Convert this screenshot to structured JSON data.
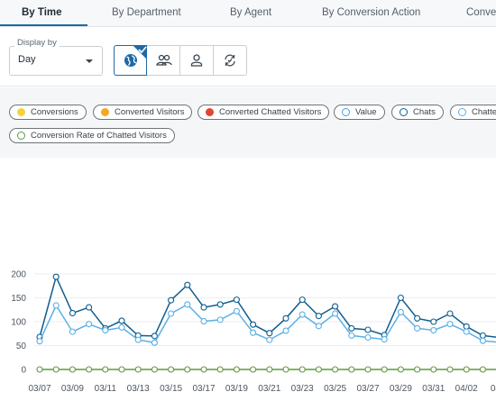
{
  "tabs": [
    {
      "label": "By Time",
      "active": true
    },
    {
      "label": "By Department",
      "active": false
    },
    {
      "label": "By Agent",
      "active": false
    },
    {
      "label": "By Conversion Action",
      "active": false
    },
    {
      "label": "Conve",
      "active": false
    }
  ],
  "toolbar": {
    "display_by_label": "Display by",
    "display_by_value": "Day",
    "view_buttons": [
      {
        "icon": "globe-icon",
        "selected": true
      },
      {
        "icon": "group-icon",
        "selected": false
      },
      {
        "icon": "person-icon",
        "selected": false
      },
      {
        "icon": "conversion-cycle-icon",
        "selected": false
      }
    ]
  },
  "legend": [
    {
      "label": "Conversions",
      "color": "#f6d23a"
    },
    {
      "label": "Converted Visitors",
      "color": "#f5a623"
    },
    {
      "label": "Converted Chatted Visitors",
      "color": "#e2452e"
    },
    {
      "label": "Value",
      "color": "#4aa3df",
      "ring": true
    },
    {
      "label": "Chats",
      "color": "#0d5d8f",
      "ring": true
    },
    {
      "label": "Chatte",
      "color": "#5aafe6",
      "ring": true
    },
    {
      "label": "Conversion Rate of Chatted Visitors",
      "color": "#5c9b3d",
      "ring": true
    }
  ],
  "chart_data": {
    "type": "line",
    "ylim": [
      0,
      200
    ],
    "yticks": [
      0,
      50,
      100,
      150,
      200
    ],
    "x_tick_labels": [
      "03/07",
      "03/09",
      "03/11",
      "03/13",
      "03/15",
      "03/17",
      "03/19",
      "03/21",
      "03/23",
      "03/25",
      "03/27",
      "03/29",
      "03/31",
      "04/02",
      "04/0"
    ],
    "series": [
      {
        "name": "Chats",
        "color": "#0d5d8f",
        "values": [
          68,
          194,
          118,
          130,
          86,
          102,
          71,
          70,
          145,
          177,
          130,
          136,
          146,
          94,
          76,
          107,
          146,
          112,
          132,
          86,
          83,
          72,
          150,
          107,
          100,
          117,
          90,
          71,
          67
        ]
      },
      {
        "name": "Chatte",
        "color": "#5aafe6",
        "values": [
          59,
          134,
          79,
          95,
          82,
          88,
          62,
          56,
          117,
          136,
          101,
          104,
          122,
          77,
          62,
          81,
          115,
          91,
          117,
          71,
          67,
          63,
          120,
          86,
          82,
          95,
          79,
          60,
          57
        ]
      },
      {
        "name": "Conversion Rate of Chatted Visitors",
        "color": "#5c9b3d",
        "values": [
          0,
          0,
          0,
          0,
          0,
          0,
          0,
          0,
          0,
          0,
          0,
          0,
          0,
          0,
          0,
          0,
          0,
          0,
          0,
          0,
          0,
          0,
          0,
          0,
          0,
          0,
          0,
          0,
          0
        ]
      }
    ]
  }
}
